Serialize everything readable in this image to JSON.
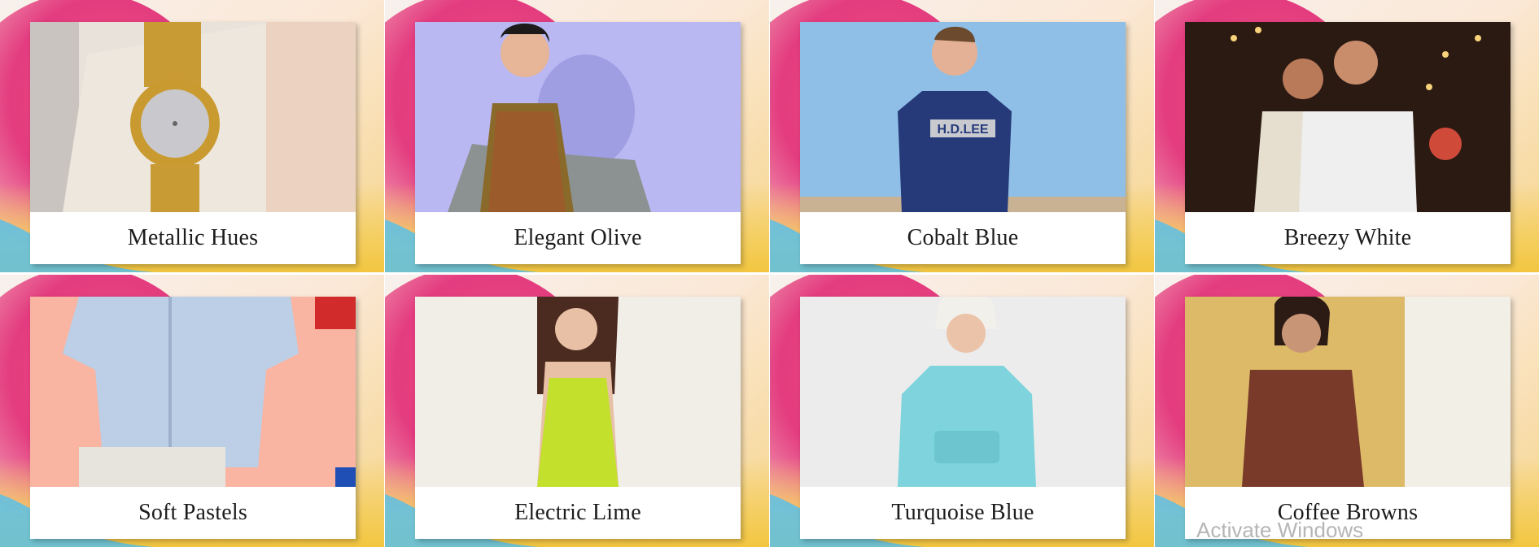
{
  "tiles": [
    {
      "label": "Metallic Hues",
      "photo": "gold-watch"
    },
    {
      "label": "Elegant Olive",
      "photo": "woman-olive-dress"
    },
    {
      "label": "Cobalt Blue",
      "photo": "man-blue-tshirt"
    },
    {
      "label": "Breezy White",
      "photo": "men-white-shirts"
    },
    {
      "label": "Soft Pastels",
      "photo": "kids-shirt-shorts"
    },
    {
      "label": "Electric Lime",
      "photo": "woman-lime-dress"
    },
    {
      "label": "Turquoise Blue",
      "photo": "girl-turquoise-hoodie"
    },
    {
      "label": "Coffee Browns",
      "photo": "woman-brown-top"
    }
  ],
  "watermark": "Activate Windows"
}
